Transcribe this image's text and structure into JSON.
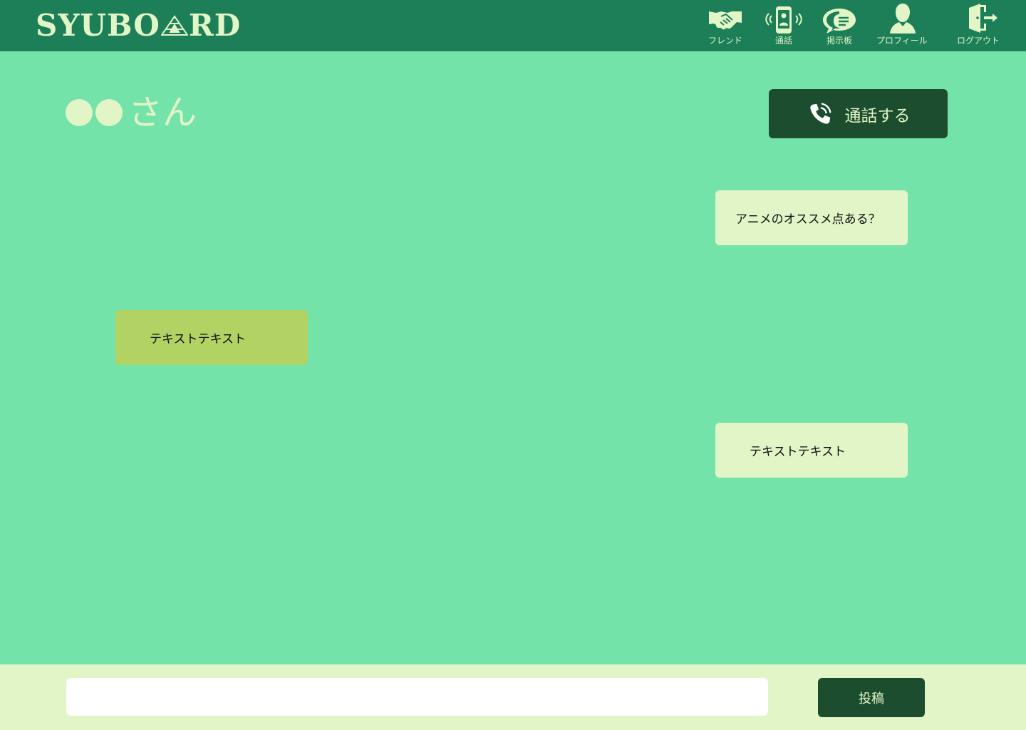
{
  "app": {
    "logo_text_left": "SYUBO",
    "logo_text_right": "RD"
  },
  "nav": [
    {
      "label": "フレンド",
      "icon": "handshake-icon"
    },
    {
      "label": "通話",
      "icon": "phone-call-icon"
    },
    {
      "label": "掲示板",
      "icon": "chat-bubble-icon"
    },
    {
      "label": "プロフィール",
      "icon": "person-icon"
    },
    {
      "label": "ログアウト",
      "icon": "logout-door-icon"
    }
  ],
  "chat": {
    "partner_name": "さん",
    "call_button_label": "通話する",
    "messages": [
      {
        "side": "received",
        "text": "アニメのオススメ点ある？"
      },
      {
        "side": "sent",
        "text": "テキストテキスト"
      },
      {
        "side": "received",
        "text": "テキストテキスト"
      }
    ]
  },
  "composer": {
    "input_value": "",
    "input_placeholder": "",
    "post_label": "投稿"
  },
  "colors": {
    "header_bg": "#1c7f58",
    "page_bg": "#73e3a9",
    "accent_light": "#e2f5c7",
    "button_dark": "#1b4d2e",
    "sent_bubble": "#b2d263"
  }
}
